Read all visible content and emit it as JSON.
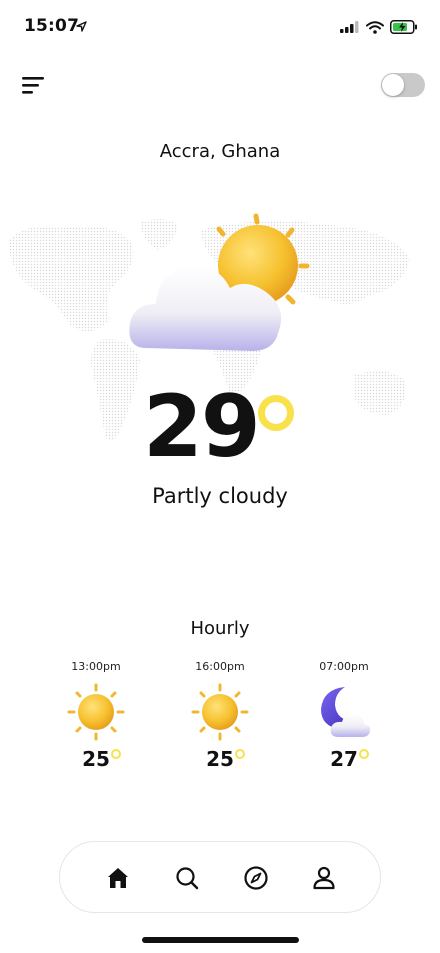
{
  "status_bar": {
    "time": "15:07"
  },
  "header": {
    "city": "Accra, Ghana",
    "theme_toggle_on": false
  },
  "current": {
    "temperature": "29",
    "condition": "Partly cloudy",
    "icon": "partly-cloudy-icon"
  },
  "hourly": {
    "title": "Hourly",
    "items": [
      {
        "time": "13:00pm",
        "temp": "25",
        "icon": "sun-icon"
      },
      {
        "time": "16:00pm",
        "temp": "25",
        "icon": "sun-icon"
      },
      {
        "time": "07:00pm",
        "temp": "27",
        "icon": "moon-cloud-icon"
      }
    ]
  },
  "nav": {
    "items": [
      {
        "name": "home",
        "icon": "home-icon",
        "active": true
      },
      {
        "name": "search",
        "icon": "search-icon",
        "active": false
      },
      {
        "name": "explore",
        "icon": "compass-icon",
        "active": false
      },
      {
        "name": "profile",
        "icon": "user-icon",
        "active": false
      }
    ]
  },
  "colors": {
    "accent": "#f8e14a",
    "sun": "#f2c12e",
    "moon": "#5b46d8",
    "text": "#111111"
  }
}
